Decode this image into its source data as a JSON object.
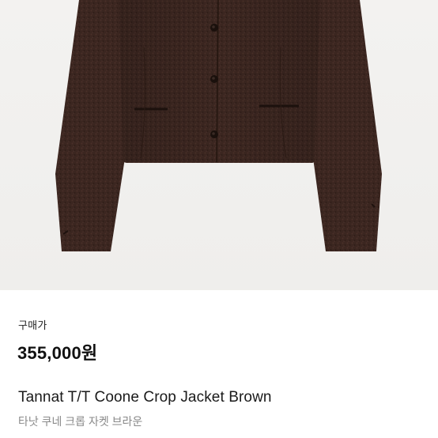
{
  "product": {
    "image_alt": "Brown tweed cropped jacket",
    "image_color": "#3a2620",
    "price_label": "구매가",
    "price": "355,000원",
    "name_en": "Tannat T/T Coone Crop Jacket Brown",
    "name_ko": "타낫 쿠네 크롭 자켓 브라운"
  }
}
